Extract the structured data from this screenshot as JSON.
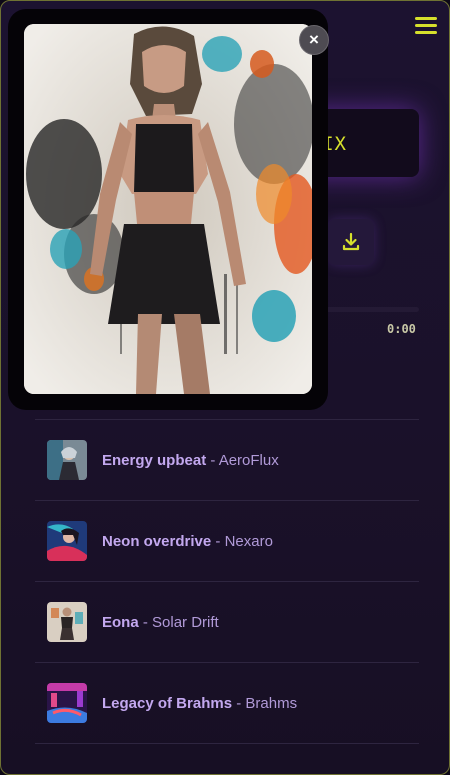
{
  "player": {
    "banner_text": "RIX",
    "time": "0:00",
    "progress": 0
  },
  "tracks": [
    {
      "title": "Energy upbeat",
      "separator": " - ",
      "artist": "AeroFlux"
    },
    {
      "title": "Neon overdrive",
      "separator": " - ",
      "artist": "Nexaro"
    },
    {
      "title": "Eona",
      "separator": " - ",
      "artist": "Solar Drift"
    },
    {
      "title": "Legacy of Brahms",
      "separator": " - ",
      "artist": "Brahms"
    }
  ],
  "modal": {
    "close_label": "×"
  },
  "colors": {
    "accent": "#d6e02c",
    "track_title": "#c3a8ef",
    "glow": "#8c3cdc"
  }
}
